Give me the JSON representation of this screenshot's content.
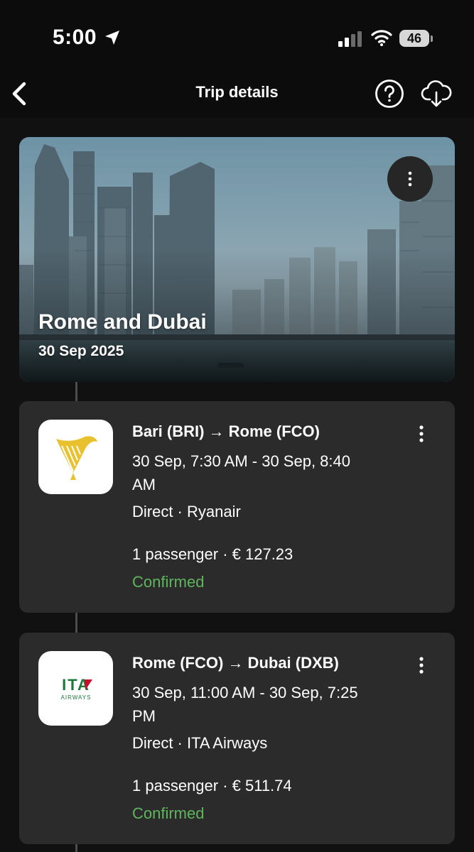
{
  "status_bar": {
    "time": "5:00",
    "battery": "46",
    "icons": [
      "location-arrow-icon",
      "cellular-signal-icon",
      "wifi-icon",
      "battery-icon"
    ]
  },
  "nav": {
    "title": "Trip details",
    "icons": [
      "chevron-left-icon",
      "help-circle-icon",
      "cloud-download-icon"
    ]
  },
  "trip": {
    "title": "Rome and Dubai",
    "date": "30 Sep 2025",
    "menu_icon": "more-vertical-icon"
  },
  "flights": [
    {
      "route": "Bari (BRI) → Rome (FCO)",
      "times": "30 Sep, 7:30 AM - 30 Sep, 8:40 AM",
      "details": "Direct · Ryanair",
      "price": "1 passenger · € 127.23",
      "status": "Confirmed",
      "logo_icon": "ryanair-harp-logo",
      "menu_icon": "more-vertical-icon"
    },
    {
      "route": "Rome (FCO) → Dubai (DXB)",
      "times": "30 Sep, 11:00 AM - 30 Sep, 7:25 PM",
      "details": "Direct · ITA Airways",
      "price": "1 passenger · € 511.74",
      "status": "Confirmed",
      "logo_icon": "ita-airways-logo",
      "logo_text": "ITA",
      "logo_subtext": "AIRWAYS",
      "menu_icon": "more-vertical-icon"
    }
  ],
  "colors": {
    "background": "#111111",
    "card": "#2b2b2b",
    "confirmed": "#5fb55c",
    "ryanair_yellow": "#e9c12f",
    "ita_green": "#1b7a3a",
    "ita_red": "#c8102e"
  }
}
